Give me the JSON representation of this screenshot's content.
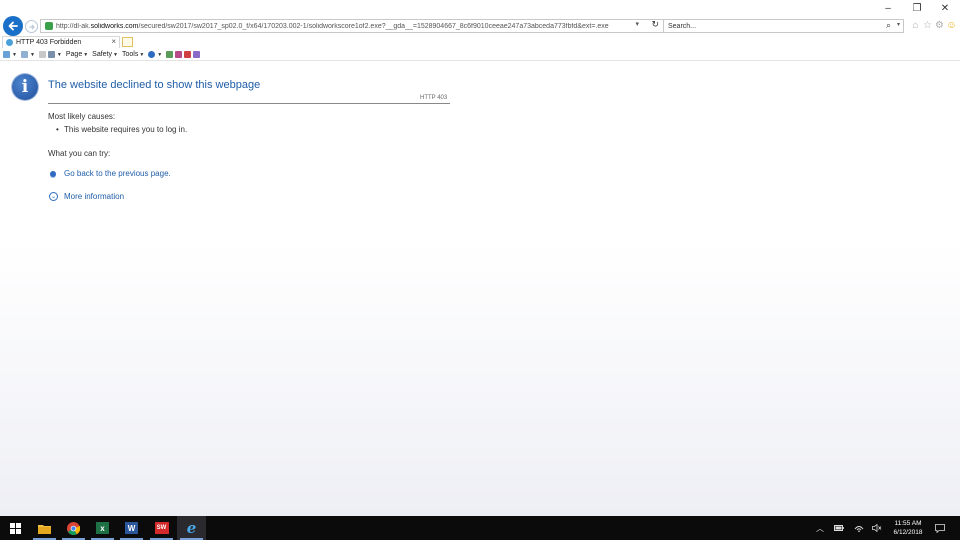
{
  "window": {
    "minimize_glyph": "–",
    "restore_glyph": "❐",
    "close_glyph": "✕"
  },
  "address_bar": {
    "url_prefix": "http://dl-ak.",
    "url_domain": "solidworks.com",
    "url_rest": "/secured/sw2017/sw2017_sp02.0_f/x64/170203.002-1/solidworkscore1of2.exe?__gda__=1528904667_8c6f9010ceeae247a73abceda773fbfd&ext=.exe",
    "search_placeholder": "Search..."
  },
  "tab": {
    "title": "HTTP 403 Forbidden",
    "close_glyph": "×"
  },
  "command_bar": {
    "page_label": "Page",
    "safety_label": "Safety",
    "tools_label": "Tools"
  },
  "page": {
    "heading": "The website declined to show this webpage",
    "http_code": "HTTP 403",
    "causes_label": "Most likely causes:",
    "cause_1": "This website requires you to log in.",
    "try_label": "What you can try:",
    "go_back_link": "Go back to the previous page.",
    "more_info_link": "More information"
  },
  "taskbar": {
    "apps": [
      "windows-start",
      "file-explorer",
      "chrome",
      "excel",
      "word",
      "solidworks",
      "internet-explorer"
    ],
    "excel_letter": "x",
    "word_letter": "W",
    "sw_letters": "SW",
    "ie_letter": "e",
    "time": "11:55 AM",
    "date": "6/12/2018"
  },
  "colors": {
    "accent": "#1a6fc9",
    "link": "#1f5da8",
    "taskbar": "#0b0b0c"
  }
}
